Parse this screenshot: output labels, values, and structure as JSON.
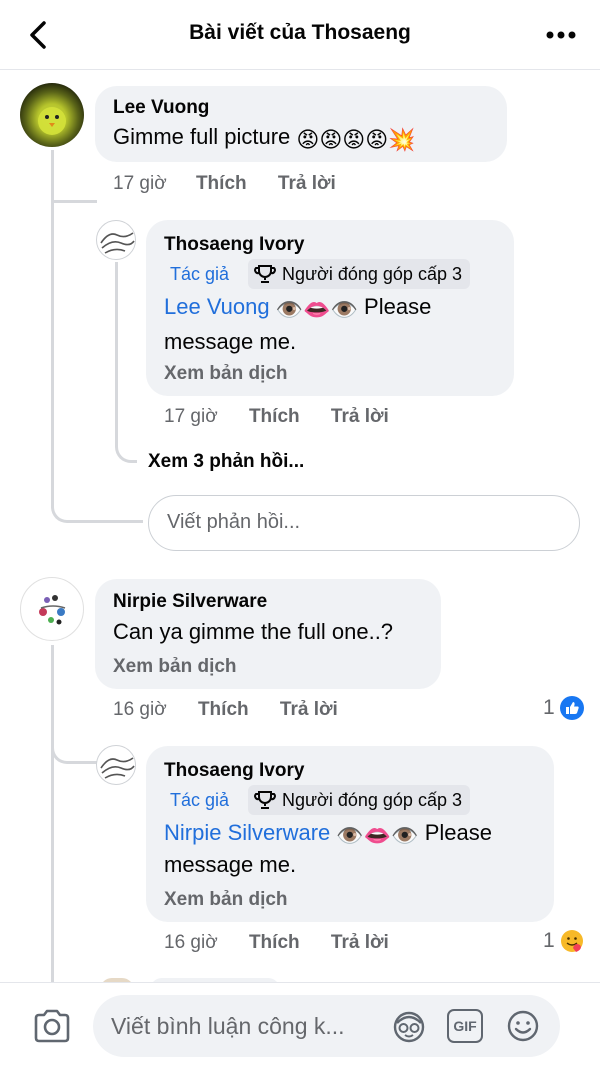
{
  "header": {
    "title": "Bài viết của Thosaeng",
    "back_icon": "chevron-left-icon",
    "more_icon": "more-dots-icon"
  },
  "comments": [
    {
      "author": "Lee Vuong",
      "text": "Gimme full picture",
      "emojis": "😡😡😡😡💥",
      "time": "17 giờ",
      "like": "Thích",
      "reply": "Trả lời",
      "replies": [
        {
          "author": "Thosaeng Ivory",
          "badge_author": "Tác giả",
          "badge_contributor": "Người đóng góp cấp 3",
          "mention": "Lee Vuong",
          "emojis": "👁️👄👁️",
          "text_after": " Please message me.",
          "translate": "Xem bản dịch",
          "time": "17 giờ",
          "like": "Thích",
          "reply": "Trả lời"
        }
      ],
      "view_more_replies": "Xem 3 phản hồi...",
      "reply_placeholder": "Viết phản hồi..."
    },
    {
      "author": "Nirpie Silverware",
      "text": "Can ya gimme the full one..?",
      "translate": "Xem bản dịch",
      "time": "16 giờ",
      "like": "Thích",
      "reply": "Trả lời",
      "reaction_count": "1",
      "replies": [
        {
          "author": "Thosaeng Ivory",
          "badge_author": "Tác giả",
          "badge_contributor": "Người đóng góp cấp 3",
          "mention": "Nirpie Silverware",
          "emojis": "👁️👄👁️",
          "text_after": " Please",
          "text_line2": "message me.",
          "translate": "Xem bản dịch",
          "time": "16 giờ",
          "like": "Thích",
          "reply": "Trả lời",
          "reaction_count": "1"
        }
      ]
    }
  ],
  "composer": {
    "placeholder": "Viết bình luận công k...",
    "camera_icon": "camera-icon",
    "avatar_icon": "avatar-sticker-icon",
    "gif_label": "GIF",
    "emoji_icon": "smiley-icon"
  },
  "colors": {
    "mention": "#216fdb",
    "like_blue": "#1877f2",
    "bubble": "#f0f2f5",
    "secondary_text": "#65676b"
  }
}
